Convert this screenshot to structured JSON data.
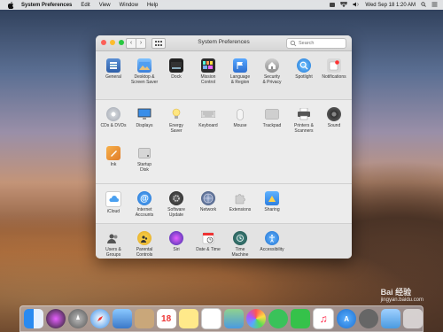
{
  "menubar": {
    "app": "System Preferences",
    "items": [
      "Edit",
      "View",
      "Window",
      "Help"
    ],
    "clock": "Wed Sep 18  1:20 AM"
  },
  "window": {
    "title": "System Preferences",
    "search_placeholder": "Search",
    "nav_back": "‹",
    "nav_forward": "›"
  },
  "panes": {
    "row1": [
      "General",
      "Desktop &\nScreen Saver",
      "Dock",
      "Mission\nControl",
      "Language\n& Region",
      "Security\n& Privacy",
      "Spotlight",
      "Notifications"
    ],
    "row2": [
      "CDs & DVDs",
      "Displays",
      "Energy\nSaver",
      "Keyboard",
      "Mouse",
      "Trackpad",
      "Printers &\nScanners",
      "Sound"
    ],
    "row3": [
      "Ink",
      "Startup\nDisk"
    ],
    "row4": [
      "iCloud",
      "Internet\nAccounts",
      "Software\nUpdate",
      "Network",
      "Extensions",
      "Sharing"
    ],
    "row5": [
      "Users &\nGroups",
      "Parental\nControls",
      "Siri",
      "Date & Time",
      "Time\nMachine",
      "Accessibility"
    ]
  },
  "watermark": {
    "brand": "Bai 经验",
    "url": "jingyan.baidu.com"
  },
  "colors": {
    "close": "#fc5f57",
    "minimize": "#fdbc2e",
    "zoom": "#28c840"
  }
}
